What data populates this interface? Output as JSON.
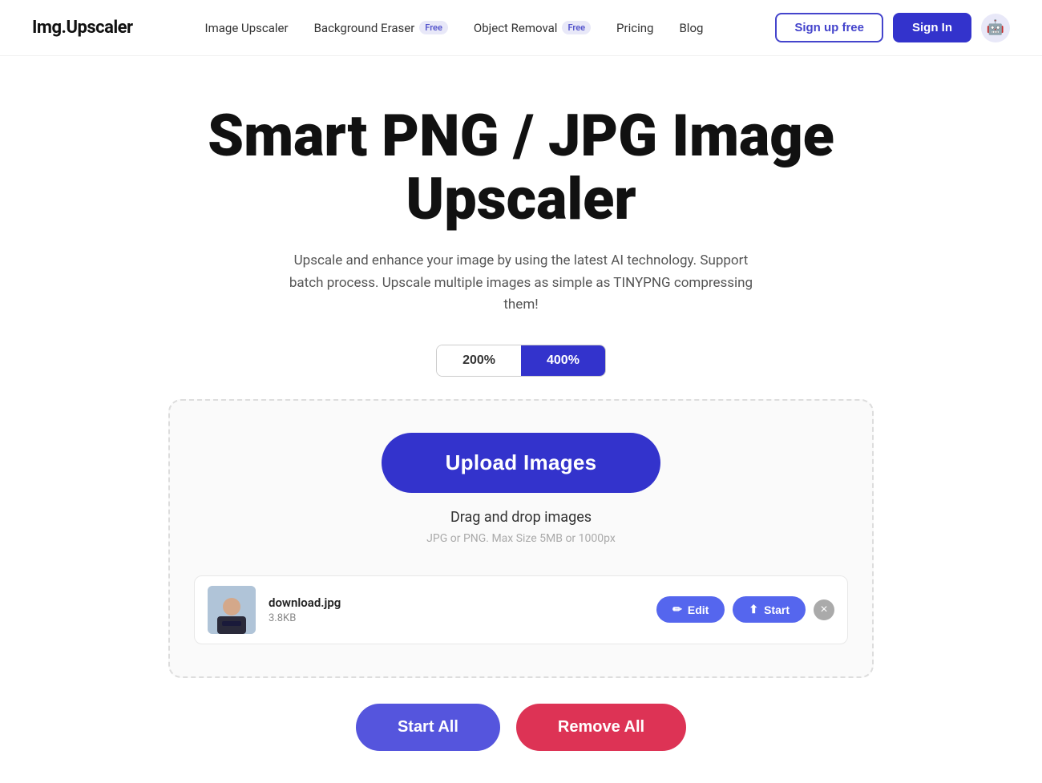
{
  "header": {
    "logo": "Img.Upscaler",
    "nav": [
      {
        "label": "Image Upscaler",
        "badge": null,
        "id": "image-upscaler"
      },
      {
        "label": "Background Eraser",
        "badge": "Free",
        "id": "background-eraser"
      },
      {
        "label": "Object Removal",
        "badge": "Free",
        "id": "object-removal"
      },
      {
        "label": "Pricing",
        "badge": null,
        "id": "pricing"
      },
      {
        "label": "Blog",
        "badge": null,
        "id": "blog"
      }
    ],
    "signup_label": "Sign up free",
    "signin_label": "Sign In"
  },
  "hero": {
    "title": "Smart PNG / JPG Image Upscaler",
    "subtitle": "Upscale and enhance your image by using the latest AI technology. Support batch process. Upscale multiple images as simple as TINYPNG compressing them!"
  },
  "scale_toggle": {
    "options": [
      "200%",
      "400%"
    ],
    "active": "400%"
  },
  "upload": {
    "button_label": "Upload Images",
    "drag_text": "Drag and drop images",
    "hint_text": "JPG or PNG. Max Size 5MB or 1000px"
  },
  "files": [
    {
      "name": "download.jpg",
      "size": "3.8KB",
      "edit_label": "Edit",
      "start_label": "Start"
    }
  ],
  "bottom_actions": {
    "start_all_label": "Start All",
    "remove_all_label": "Remove All"
  },
  "icons": {
    "edit_icon": "✎",
    "start_icon": "↑",
    "remove_icon": "×",
    "avatar_icon": "🤖"
  }
}
